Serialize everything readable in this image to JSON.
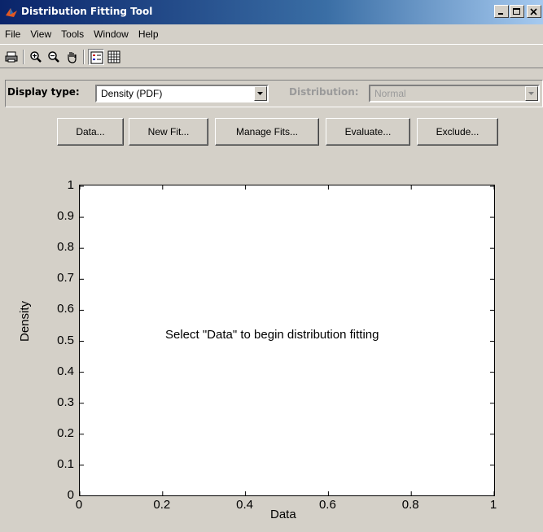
{
  "window": {
    "title": "Distribution Fitting Tool"
  },
  "menu": [
    "File",
    "View",
    "Tools",
    "Window",
    "Help"
  ],
  "toolbar": {
    "icons": [
      "print-icon",
      "zoom-in-icon",
      "zoom-out-icon",
      "pan-hand-icon",
      "legend-icon",
      "grid-icon"
    ]
  },
  "display": {
    "type_label": "Display type:",
    "type_value": "Density (PDF)",
    "dist_label": "Distribution:",
    "dist_value": "Normal"
  },
  "buttons": {
    "data": "Data...",
    "new_fit": "New Fit...",
    "manage_fits": "Manage Fits...",
    "evaluate": "Evaluate...",
    "exclude": "Exclude..."
  },
  "chart_data": {
    "type": "line",
    "series": [],
    "xlabel": "Data",
    "ylabel": "Density",
    "xlim": [
      0,
      1
    ],
    "ylim": [
      0,
      1
    ],
    "xticks": [
      "0",
      "0.2",
      "0.4",
      "0.6",
      "0.8",
      "1"
    ],
    "yticks": [
      "0",
      "0.1",
      "0.2",
      "0.3",
      "0.4",
      "0.5",
      "0.6",
      "0.7",
      "0.8",
      "0.9",
      "1"
    ],
    "annotation": "Select \"Data\" to begin distribution fitting",
    "grid": false
  }
}
